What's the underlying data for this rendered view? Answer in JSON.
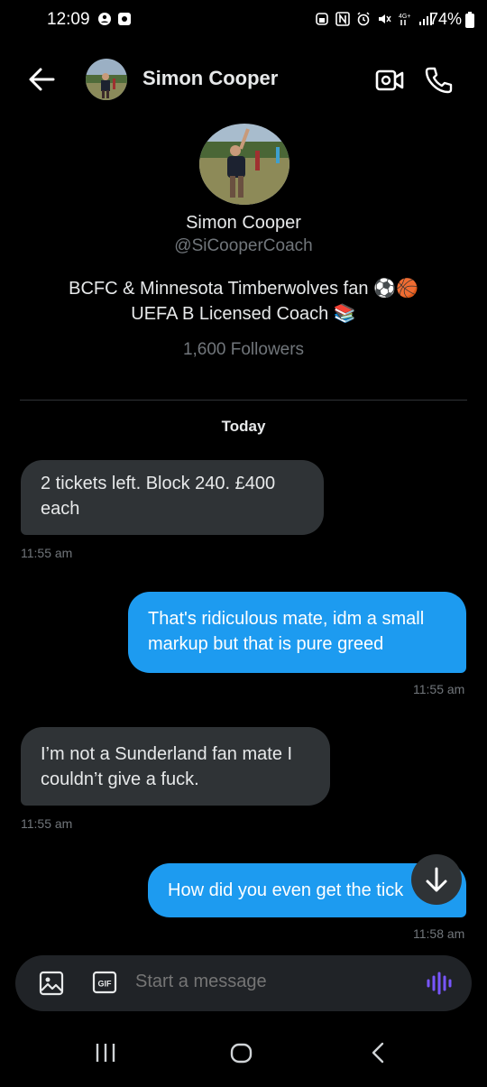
{
  "status": {
    "time": "12:09",
    "battery": "74%"
  },
  "header": {
    "contact_name": "Simon Cooper",
    "icons": [
      "back-arrow-icon",
      "video-call-icon",
      "phone-icon"
    ]
  },
  "profile": {
    "name": "Simon Cooper",
    "handle": "@SiCooperCoach",
    "bio_line1": "BCFC & Minnesota Timberwolves fan ⚽🏀",
    "bio_line2": "UEFA B Licensed Coach 📚",
    "followers": "1,600 Followers"
  },
  "chat": {
    "day_label": "Today",
    "messages": [
      {
        "direction": "in",
        "line1": "2 tickets left. Block 240. £400",
        "line2": "each",
        "time": "11:55 am"
      },
      {
        "direction": "out",
        "line1": "That's ridiculous mate, idm a small",
        "line2": "markup but that is pure greed",
        "time": "11:55 am"
      },
      {
        "direction": "in",
        "line1": "I’m not a Sunderland fan mate I",
        "line2": "couldn’t give a fuck.",
        "time": "11:55 am"
      },
      {
        "direction": "out",
        "line1": "How did you even get the tick",
        "time": "11:58 am"
      }
    ]
  },
  "composer": {
    "placeholder": "Start a message",
    "gif_label": "GIF"
  },
  "colors": {
    "background": "#000000",
    "incoming_bubble": "#2f3336",
    "outgoing_bubble": "#1d9bf0",
    "muted_text": "#71767b",
    "voice_accent": "#7856ff"
  }
}
